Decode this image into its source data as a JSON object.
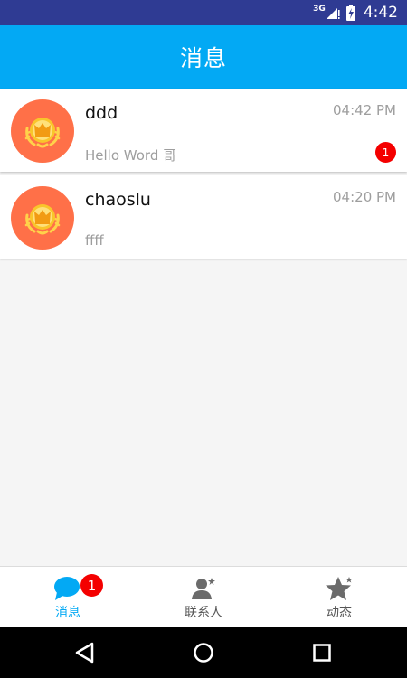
{
  "status_bar": {
    "network_type": "3G",
    "time": "4:42"
  },
  "header": {
    "title": "消息"
  },
  "conversations": [
    {
      "name": "ddd",
      "time": "04:42 PM",
      "preview": "Hello Word 哥",
      "unread": "1",
      "avatar_icon": "crown-icon"
    },
    {
      "name": "chaoslu",
      "time": "04:20 PM",
      "preview": "ffff",
      "avatar_icon": "crown-icon"
    }
  ],
  "tabs": [
    {
      "label": "消息",
      "icon": "chat-bubble-icon",
      "active": true,
      "badge": "1"
    },
    {
      "label": "联系人",
      "icon": "contacts-icon",
      "active": false
    },
    {
      "label": "动态",
      "icon": "star-icon",
      "active": false
    }
  ],
  "nav_bar": {
    "buttons": [
      "back-icon",
      "home-icon",
      "recents-icon"
    ]
  },
  "colors": {
    "status_bar": "#2f3b93",
    "app_bar": "#03a9f4",
    "avatar_bg": "#ff7048",
    "badge": "#f40000",
    "active_tab": "#03a9f4"
  }
}
